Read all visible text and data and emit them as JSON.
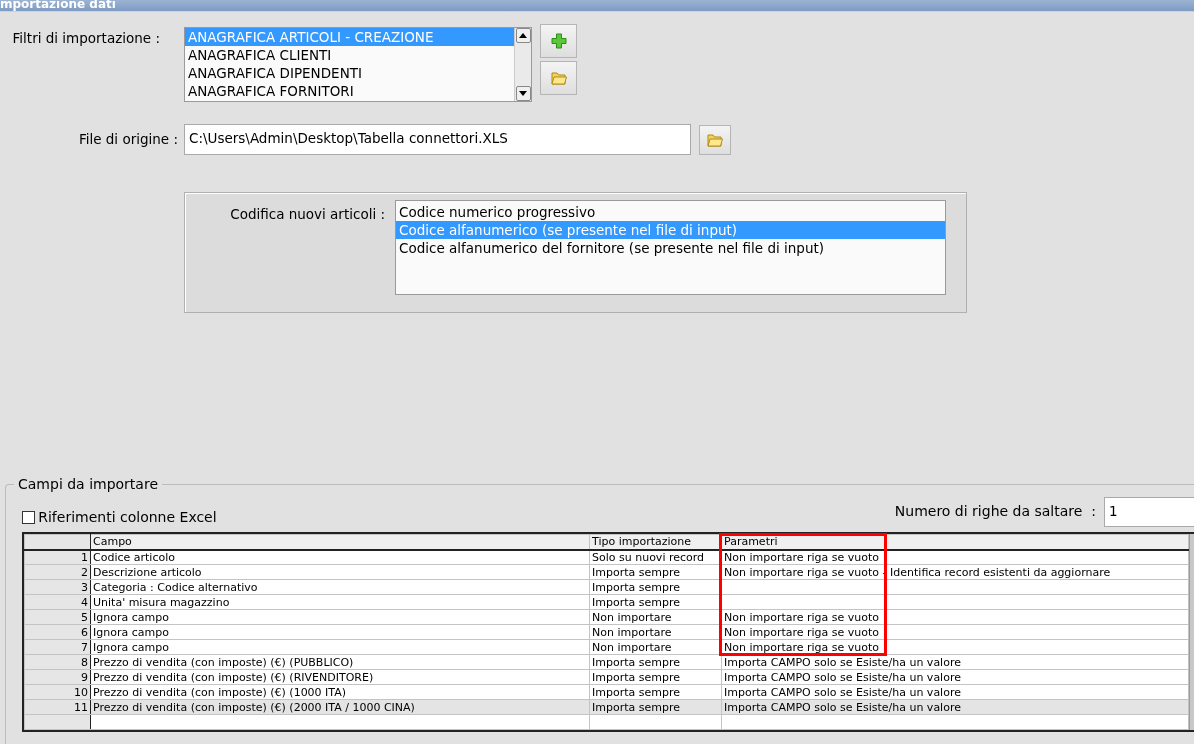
{
  "window": {
    "title": "mportazione dati"
  },
  "filters": {
    "label": "Filtri di importazione :",
    "items": [
      {
        "text": "ANAGRAFICA ARTICOLI - CREAZIONE",
        "selected": true
      },
      {
        "text": "ANAGRAFICA CLIENTI",
        "selected": false
      },
      {
        "text": "ANAGRAFICA DIPENDENTI",
        "selected": false
      },
      {
        "text": "ANAGRAFICA FORNITORI",
        "selected": false
      }
    ]
  },
  "source_file": {
    "label": "File di origine :",
    "value": "C:\\Users\\Admin\\Desktop\\Tabella connettori.XLS"
  },
  "coding": {
    "label": "Codifica nuovi articoli :",
    "items": [
      {
        "text": "Codice numerico progressivo",
        "selected": false
      },
      {
        "text": "Codice alfanumerico (se presente nel file di input)",
        "selected": true
      },
      {
        "text": "Codice alfanumerico del fornitore (se presente nel file di input)",
        "selected": false
      }
    ]
  },
  "fields_group": {
    "title": "Campi da importare",
    "excel_refs": {
      "label": "Riferimenti colonne Excel",
      "checked": false
    },
    "skip_rows": {
      "label": "Numero di righe da saltare  :",
      "value": "1"
    },
    "table": {
      "columns": [
        {
          "title": "Campo",
          "highlighted": false
        },
        {
          "title": "Tipo importazione",
          "highlighted": false
        },
        {
          "title": "Parametri",
          "highlighted": true
        }
      ],
      "rows": [
        {
          "number": "1",
          "cells": [
            "Codice articolo",
            "Solo su nuovi record",
            "Non importare riga se vuoto"
          ],
          "selected": false
        },
        {
          "number": "2",
          "cells": [
            "Descrizione articolo",
            "Importa sempre",
            "Non importare riga se vuoto - Identifica record esistenti da aggiornare"
          ],
          "selected": false
        },
        {
          "number": "3",
          "cells": [
            "Categoria : Codice alternativo",
            "Importa sempre",
            ""
          ],
          "selected": false
        },
        {
          "number": "4",
          "cells": [
            "Unita' misura magazzino",
            "Importa sempre",
            ""
          ],
          "selected": false
        },
        {
          "number": "5",
          "cells": [
            "Ignora campo",
            "Non importare",
            "Non importare riga se vuoto"
          ],
          "selected": false
        },
        {
          "number": "6",
          "cells": [
            "Ignora campo",
            "Non importare",
            "Non importare riga se vuoto"
          ],
          "selected": false
        },
        {
          "number": "7",
          "cells": [
            "Ignora campo",
            "Non importare",
            "Non importare riga se vuoto"
          ],
          "selected": false
        },
        {
          "number": "8",
          "cells": [
            "Prezzo di vendita (con imposte) (€) (PUBBLICO)",
            "Importa sempre",
            "Importa CAMPO solo se Esiste/ha un valore"
          ],
          "selected": false
        },
        {
          "number": "9",
          "cells": [
            "Prezzo di vendita (con imposte) (€) (RIVENDITORE)",
            "Importa sempre",
            "Importa CAMPO solo se Esiste/ha un valore"
          ],
          "selected": false
        },
        {
          "number": "10",
          "cells": [
            "Prezzo di vendita (con imposte) (€) (1000 ITA)",
            "Importa sempre",
            "Importa CAMPO solo se Esiste/ha un valore"
          ],
          "selected": false
        },
        {
          "number": "11",
          "cells": [
            "Prezzo di vendita (con imposte) (€) (2000 ITA / 1000 CINA)",
            "Importa sempre",
            "Importa CAMPO solo se Esiste/ha un valore"
          ],
          "selected": true
        }
      ]
    }
  }
}
